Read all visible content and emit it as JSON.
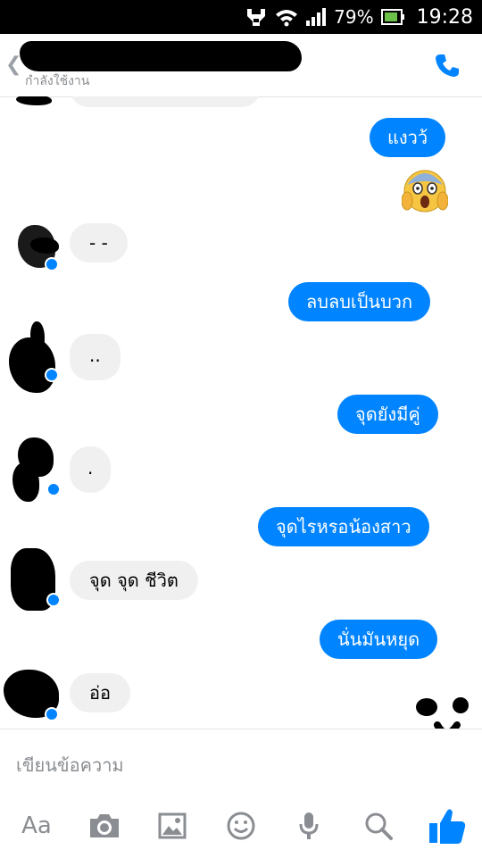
{
  "status_bar": {
    "battery_percent": "79%",
    "time": "19:28",
    "icons": [
      "usb-icon",
      "wifi-icon",
      "signal-icon",
      "battery-icon"
    ]
  },
  "header": {
    "back_glyph": "❮",
    "status": "กำลังใช้งาน",
    "call_icon": "phone-icon"
  },
  "messages": [
    {
      "from": "me",
      "text": "แงวว้"
    },
    {
      "from": "them",
      "text": "- -"
    },
    {
      "from": "me",
      "text": "ลบลบเป็นบวก"
    },
    {
      "from": "them",
      "text": ".."
    },
    {
      "from": "me",
      "text": "จุดยังมีคู่"
    },
    {
      "from": "them",
      "text": "."
    },
    {
      "from": "me",
      "text": "จุดไรหรอน้องสาว"
    },
    {
      "from": "them",
      "text": "จุด จุด ชีวิต"
    },
    {
      "from": "me",
      "text": "นั่นมันหยุด"
    },
    {
      "from": "them",
      "text": "อ่อ"
    }
  ],
  "reaction_emoji": "scream-emoji",
  "composer": {
    "placeholder": "เขียนข้อความ",
    "tools": {
      "text_label": "Aa",
      "camera": "camera-icon",
      "gallery": "image-icon",
      "emoji": "smiley-icon",
      "mic": "microphone-icon",
      "search": "search-icon",
      "like": "thumbs-up-icon"
    }
  },
  "colors": {
    "accent": "#0084ff",
    "incoming_bubble": "#f1f0f0",
    "muted": "#8a8d91"
  }
}
